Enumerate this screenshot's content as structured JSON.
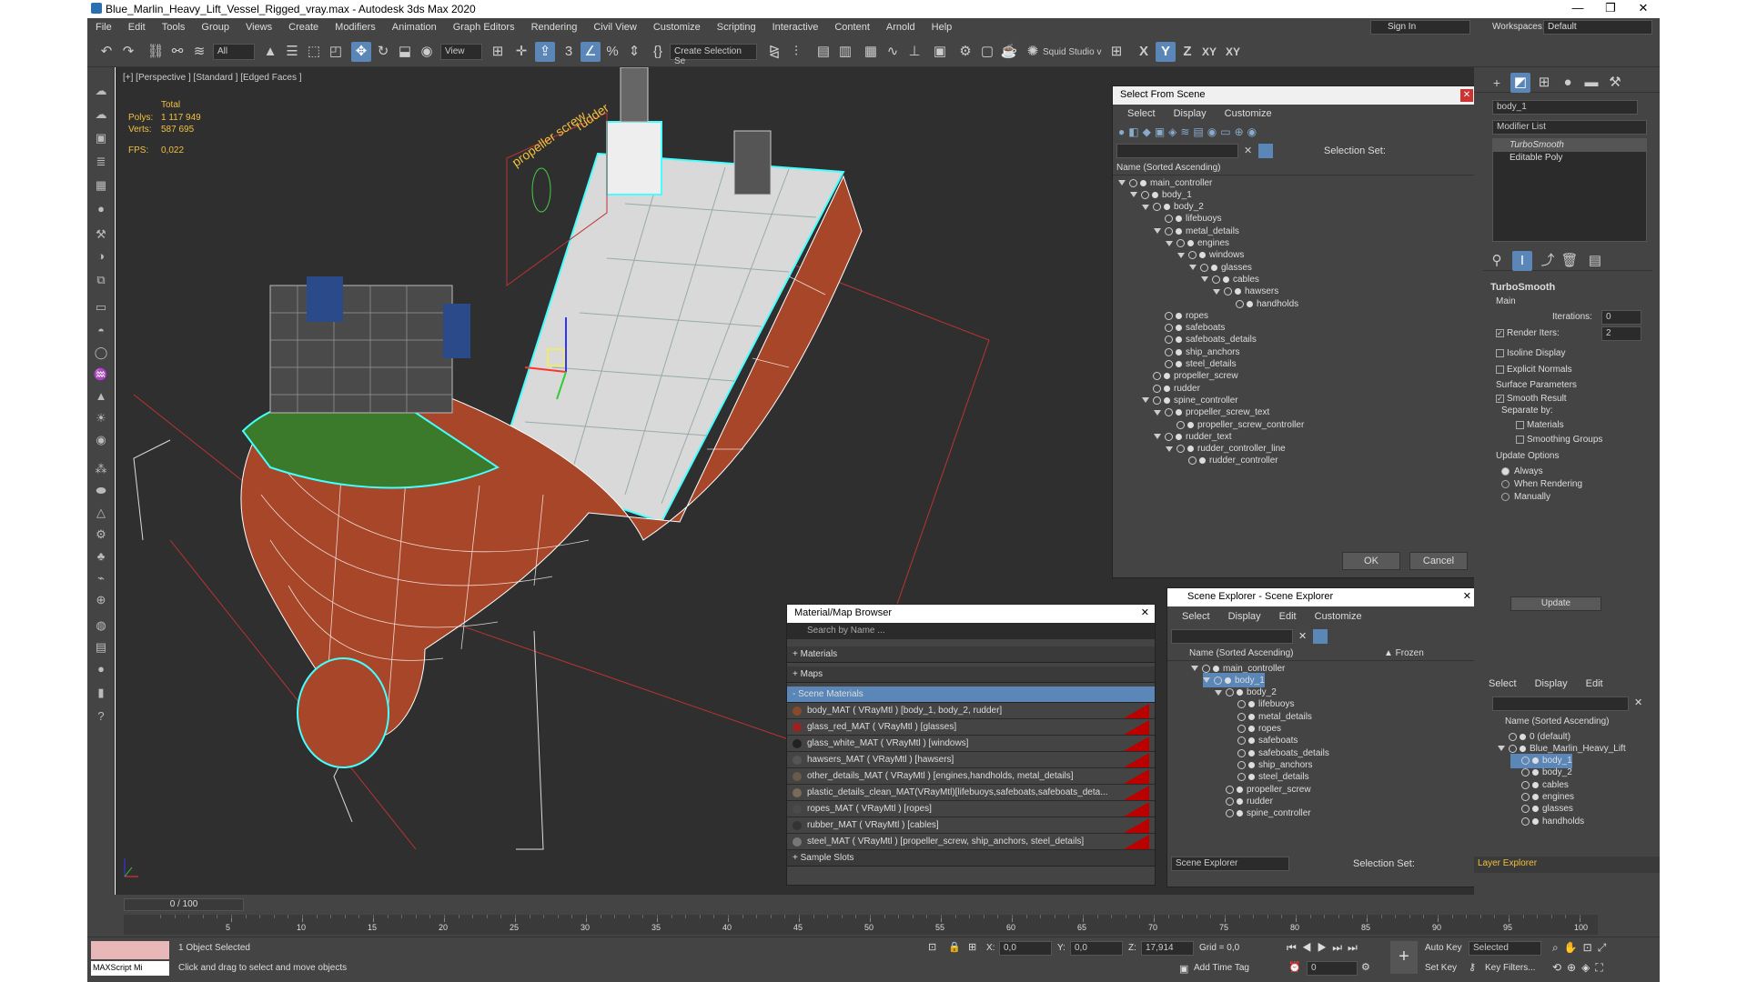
{
  "window": {
    "title": "Blue_Marlin_Heavy_Lift_Vessel_Rigged_vray.max - Autodesk 3ds Max 2020",
    "minimize": "—",
    "maximize": "❐",
    "close": "✕"
  },
  "menu": [
    "File",
    "Edit",
    "Tools",
    "Group",
    "Views",
    "Create",
    "Modifiers",
    "Animation",
    "Graph Editors",
    "Rendering",
    "Civil View",
    "Customize",
    "Scripting",
    "Interactive",
    "Content",
    "Arnold",
    "Help"
  ],
  "signin": {
    "label": "Sign In",
    "workspaces_label": "Workspaces:",
    "workspace": "Default"
  },
  "toolbar": {
    "filter": "All",
    "view": "View",
    "selection_set": "Create Selection Se",
    "squid": "Squid Studio v",
    "axes": [
      "X",
      "Y",
      "Z",
      "XY",
      "XY"
    ]
  },
  "viewport": {
    "label": "[+] [Perspective ] [Standard ] [Edged Faces ]",
    "stats": {
      "total": "Total",
      "polys_label": "Polys:",
      "polys": "1 117 949",
      "verts_label": "Verts:",
      "verts": "587 695",
      "fps_label": "FPS:",
      "fps": "0,022"
    },
    "text_propeller": "propeller screw",
    "text_rudder": "rudder"
  },
  "select_from_scene": {
    "title": "Select From Scene",
    "menu": [
      "Select",
      "Display",
      "Customize"
    ],
    "selection_set": "Selection Set:",
    "column": "Name (Sorted Ascending)",
    "ok": "OK",
    "cancel": "Cancel",
    "items": [
      {
        "name": "main_controller",
        "level": 0
      },
      {
        "name": "body_1",
        "level": 1
      },
      {
        "name": "body_2",
        "level": 2
      },
      {
        "name": "lifebuoys",
        "level": 3
      },
      {
        "name": "metal_details",
        "level": 3
      },
      {
        "name": "engines",
        "level": 4
      },
      {
        "name": "windows",
        "level": 5
      },
      {
        "name": "glasses",
        "level": 6
      },
      {
        "name": "cables",
        "level": 7
      },
      {
        "name": "hawsers",
        "level": 8
      },
      {
        "name": "handholds",
        "level": 9
      },
      {
        "name": "ropes",
        "level": 3
      },
      {
        "name": "safeboats",
        "level": 3
      },
      {
        "name": "safeboats_details",
        "level": 3
      },
      {
        "name": "ship_anchors",
        "level": 3
      },
      {
        "name": "steel_details",
        "level": 3
      },
      {
        "name": "propeller_screw",
        "level": 2
      },
      {
        "name": "rudder",
        "level": 2
      },
      {
        "name": "spine_controller",
        "level": 2
      },
      {
        "name": "propeller_screw_text",
        "level": 3
      },
      {
        "name": "propeller_screw_controller",
        "level": 4
      },
      {
        "name": "rudder_text",
        "level": 3
      },
      {
        "name": "rudder_controller_line",
        "level": 4
      },
      {
        "name": "rudder_controller",
        "level": 5
      }
    ]
  },
  "material_browser": {
    "title": "Material/Map Browser",
    "search": "Search by Name ...",
    "materials": "+ Materials",
    "maps": "+ Maps",
    "scene_materials": "- Scene Materials",
    "sample_slots": "+ Sample Slots",
    "items": [
      {
        "name": "body_MAT ( VRayMtl ) [body_1, body_2, rudder]",
        "color": "#8a4a2a"
      },
      {
        "name": "glass_red_MAT ( VRayMtl ) [glasses]",
        "color": "#a02020"
      },
      {
        "name": "glass_white_MAT ( VRayMtl ) [windows]",
        "color": "#222222"
      },
      {
        "name": "hawsers_MAT ( VRayMtl ) [hawsers]",
        "color": "#555555"
      },
      {
        "name": "other_details_MAT ( VRayMtl ) [engines,handholds, metal_details]",
        "color": "#6a5a4a"
      },
      {
        "name": "plastic_details_clean_MAT(VRayMtl)[lifebuoys,safeboats,safeboats_deta...",
        "color": "#7a6a5a"
      },
      {
        "name": "ropes_MAT ( VRayMtl ) [ropes]",
        "color": "#4a4a4a"
      },
      {
        "name": "rubber_MAT ( VRayMtl ) [cables]",
        "color": "#333333"
      },
      {
        "name": "steel_MAT ( VRayMtl ) [propeller_screw, ship_anchors, steel_details]",
        "color": "#777777"
      }
    ]
  },
  "scene_explorer": {
    "title": "Scene Explorer - Scene Explorer",
    "menu": [
      "Select",
      "Display",
      "Edit",
      "Customize"
    ],
    "column": "Name (Sorted Ascending)",
    "frozen": "▲ Frozen",
    "footer": "Scene Explorer",
    "selection_set": "Selection Set:",
    "items": [
      {
        "name": "main_controller",
        "level": 0
      },
      {
        "name": "body_1",
        "level": 1
      },
      {
        "name": "body_2",
        "level": 2
      },
      {
        "name": "lifebuoys",
        "level": 3
      },
      {
        "name": "metal_details",
        "level": 3
      },
      {
        "name": "ropes",
        "level": 3
      },
      {
        "name": "safeboats",
        "level": 3
      },
      {
        "name": "safeboats_details",
        "level": 3
      },
      {
        "name": "ship_anchors",
        "level": 3
      },
      {
        "name": "steel_details",
        "level": 3
      },
      {
        "name": "propeller_screw",
        "level": 2
      },
      {
        "name": "rudder",
        "level": 2
      },
      {
        "name": "spine_controller",
        "level": 2
      }
    ]
  },
  "command_panel": {
    "object_name": "body_1",
    "modifier_list": "Modifier List",
    "stack": [
      "TurboSmooth",
      "Editable Poly"
    ],
    "turbosmooth": "TurboSmooth",
    "main": "Main",
    "iterations_label": "Iterations:",
    "iterations": "0",
    "render_iters_label": "Render Iters:",
    "render_iters": "2",
    "isoline": "Isoline Display",
    "explicit": "Explicit Normals",
    "surface": "Surface Parameters",
    "smooth_result": "Smooth Result",
    "separate_by": "Separate by:",
    "materials": "Materials",
    "smoothing_groups": "Smoothing Groups",
    "update_options": "Update Options",
    "always": "Always",
    "when_rendering": "When Rendering",
    "manually": "Manually",
    "update": "Update"
  },
  "layer_explorer": {
    "menu": [
      "Select",
      "Display",
      "Edit"
    ],
    "column": "Name (Sorted Ascending)",
    "footer": "Layer Explorer",
    "items": [
      {
        "name": "0 (default)",
        "level": 0
      },
      {
        "name": "Blue_Marlin_Heavy_Lift",
        "level": 0
      },
      {
        "name": "body_1",
        "level": 1
      },
      {
        "name": "body_2",
        "level": 1
      },
      {
        "name": "cables",
        "level": 1
      },
      {
        "name": "engines",
        "level": 1
      },
      {
        "name": "glasses",
        "level": 1
      },
      {
        "name": "handholds",
        "level": 1
      }
    ]
  },
  "timeline": {
    "frame": "0 / 100",
    "ticks": [
      "5",
      "10",
      "15",
      "20",
      "25",
      "30",
      "35",
      "40",
      "45",
      "50",
      "55",
      "60",
      "65",
      "70",
      "75",
      "80",
      "85",
      "90",
      "95",
      "100"
    ]
  },
  "status": {
    "maxscript": "MAXScript Mi",
    "selected": "1 Object Selected",
    "hint": "Click and drag to select and move objects",
    "x_label": "X:",
    "x": "0,0",
    "y_label": "Y:",
    "y": "0,0",
    "z_label": "Z:",
    "z": "17,914",
    "grid": "Grid = 0,0",
    "add_time_tag": "Add Time Tag",
    "autokey": "Auto Key",
    "setkey": "Set Key",
    "selected_dd": "Selected",
    "key_filters": "Key Filters...",
    "frame_field": "0"
  }
}
